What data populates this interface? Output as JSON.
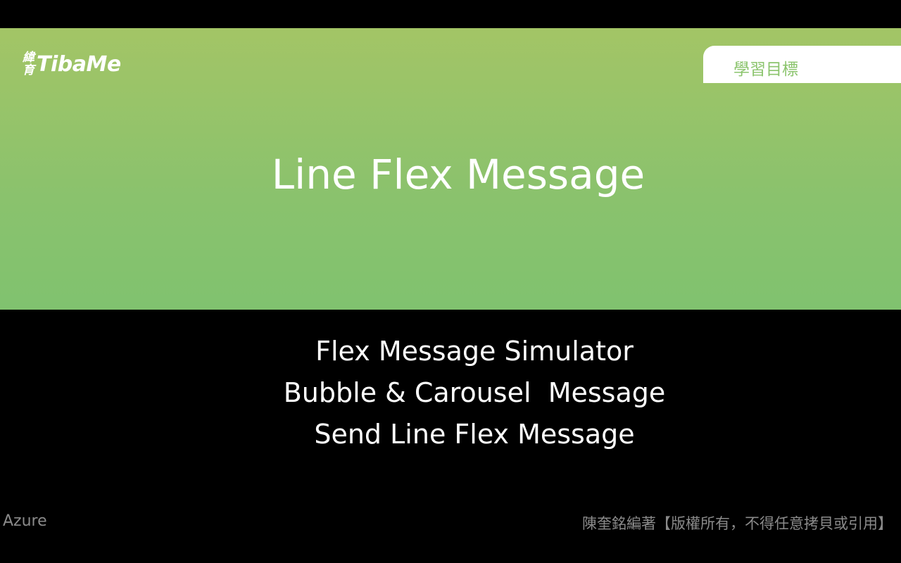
{
  "logo": {
    "cjk_top": "緯",
    "cjk_bottom": "育",
    "wordmark": "TibaMe"
  },
  "header": {
    "tab_label": "學習目標"
  },
  "hero": {
    "title": "Line Flex Message"
  },
  "objectives": [
    {
      "text": "Flex Message Simulator"
    },
    {
      "text": "Bubble & Carousel  Message"
    },
    {
      "text": "Send Line Flex Message"
    }
  ],
  "footer": {
    "course": "Azure",
    "copyright": "陳奎銘編著【版權所有，不得任意拷貝或引用】"
  },
  "colors": {
    "hero_top": "#a3c566",
    "hero_bottom": "#80c26f",
    "tab_text": "#8bc46d",
    "footer_text": "#8a8a8a"
  }
}
